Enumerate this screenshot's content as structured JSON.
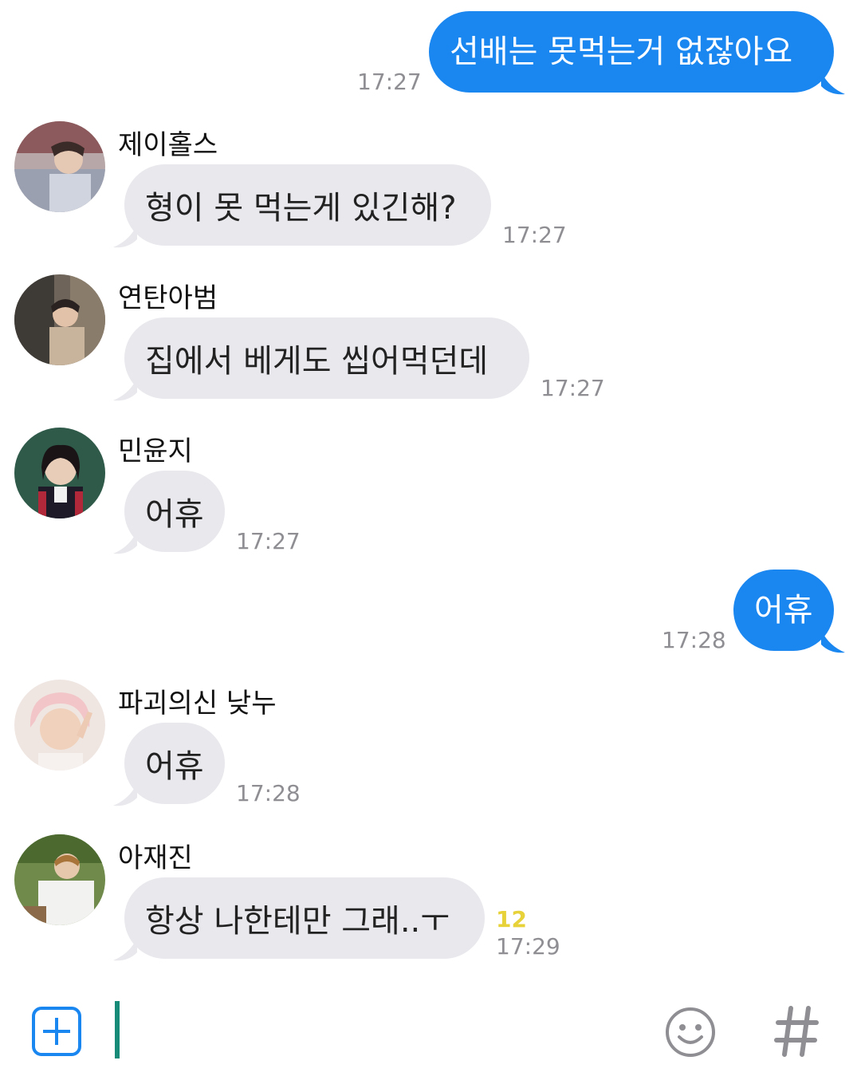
{
  "messages": [
    {
      "type": "out",
      "text": "선배는 못먹는거 없잖아요",
      "time": "17:27"
    },
    {
      "type": "in",
      "sender": "제이홀스",
      "text": "형이 못 먹는게 있긴해?",
      "time": "17:27"
    },
    {
      "type": "in",
      "sender": "연탄아범",
      "text": "집에서 베게도 씹어먹던데",
      "time": "17:27"
    },
    {
      "type": "in",
      "sender": "민윤지",
      "text": "어휴",
      "time": "17:27"
    },
    {
      "type": "out",
      "text": "어휴",
      "time": "17:28"
    },
    {
      "type": "in",
      "sender": "파괴의신 낮누",
      "text": "어휴",
      "time": "17:28"
    },
    {
      "type": "in",
      "sender": "아재진",
      "text": "항상 나한테만 그래..ㅜ",
      "time": "17:29",
      "unread": "12"
    }
  ],
  "input": {
    "plus_icon": "plus-icon",
    "emoji_icon": "emoji-icon",
    "hashtag_icon": "hashtag-icon",
    "text": ""
  },
  "colors": {
    "outgoing_bubble": "#1a86f0",
    "incoming_bubble": "#e8e8ed",
    "timestamp": "#8e8e93",
    "unread": "#e8d23a",
    "cursor": "#178a78",
    "icon_blue": "#1a86f0",
    "icon_gray": "#8e8e93"
  }
}
